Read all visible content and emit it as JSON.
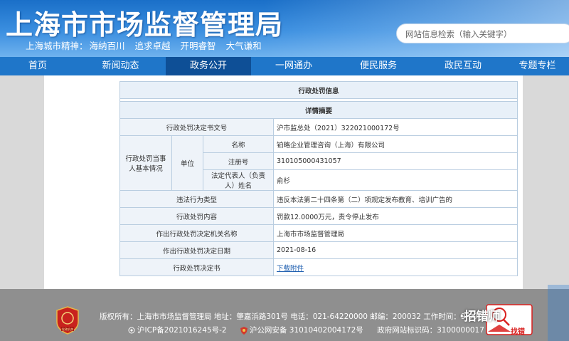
{
  "header": {
    "title": "上海市市场监督管理局",
    "slogan_prefix": "上海城市精神：",
    "slogan": [
      "海纳百川",
      "追求卓越",
      "开明睿智",
      "大气谦和"
    ],
    "search_placeholder": "网站信息检索（输入关键字）"
  },
  "nav": {
    "items": [
      {
        "label": "首页"
      },
      {
        "label": "新闻动态"
      },
      {
        "label": "政务公开"
      },
      {
        "label": "一网通办"
      },
      {
        "label": "便民服务"
      },
      {
        "label": "政民互动"
      },
      {
        "label": "专题专栏"
      }
    ],
    "active": "政务公开"
  },
  "record": {
    "section_title": "行政处罚信息",
    "subsection_title": "详情摘要",
    "doc_no_label": "行政处罚决定书文号",
    "doc_no": "沪市监总处（2021）322021000172号",
    "party_label": "行政处罚当事人基本情况",
    "unit_label": "单位",
    "name_label": "名称",
    "name": "铂略企业管理咨询（上海）有限公司",
    "reg_no_label": "注册号",
    "reg_no": "310105000431057",
    "rep_label": "法定代表人（负责人）姓名",
    "rep": "俞杉",
    "violation_label": "违法行为类型",
    "violation": "违反本法第二十四条第（二）项规定发布教育、培训广告的",
    "content_label": "行政处罚内容",
    "content": "罚款12.0000万元，责令停止发布",
    "authority_label": "作出行政处罚决定机关名称",
    "authority": "上海市市场监督管理局",
    "date_label": "作出行政处罚决定日期",
    "date": "2021-08-16",
    "decision_label": "行政处罚决定书",
    "decision_link": "下载附件"
  },
  "footer": {
    "line1": "版权所有：上海市市场监督管理局 地址：肇嘉浜路301号 电话：021-64220000 邮编：200032 工作时间：9:00-17:30",
    "icp": "沪ICP备2021016245号-2",
    "police": "沪公网安备 31010402004172号",
    "site_code": "政府网站标识码：3100000017",
    "emblem_text": "党政机关",
    "watermark": "·招错师",
    "findbug": "找错"
  },
  "colors": {
    "nav_bg": "#1f76c9",
    "nav_active": "#0e4f96",
    "footer_bg": "#8f8f8f",
    "table_border": "#b9cde0"
  }
}
